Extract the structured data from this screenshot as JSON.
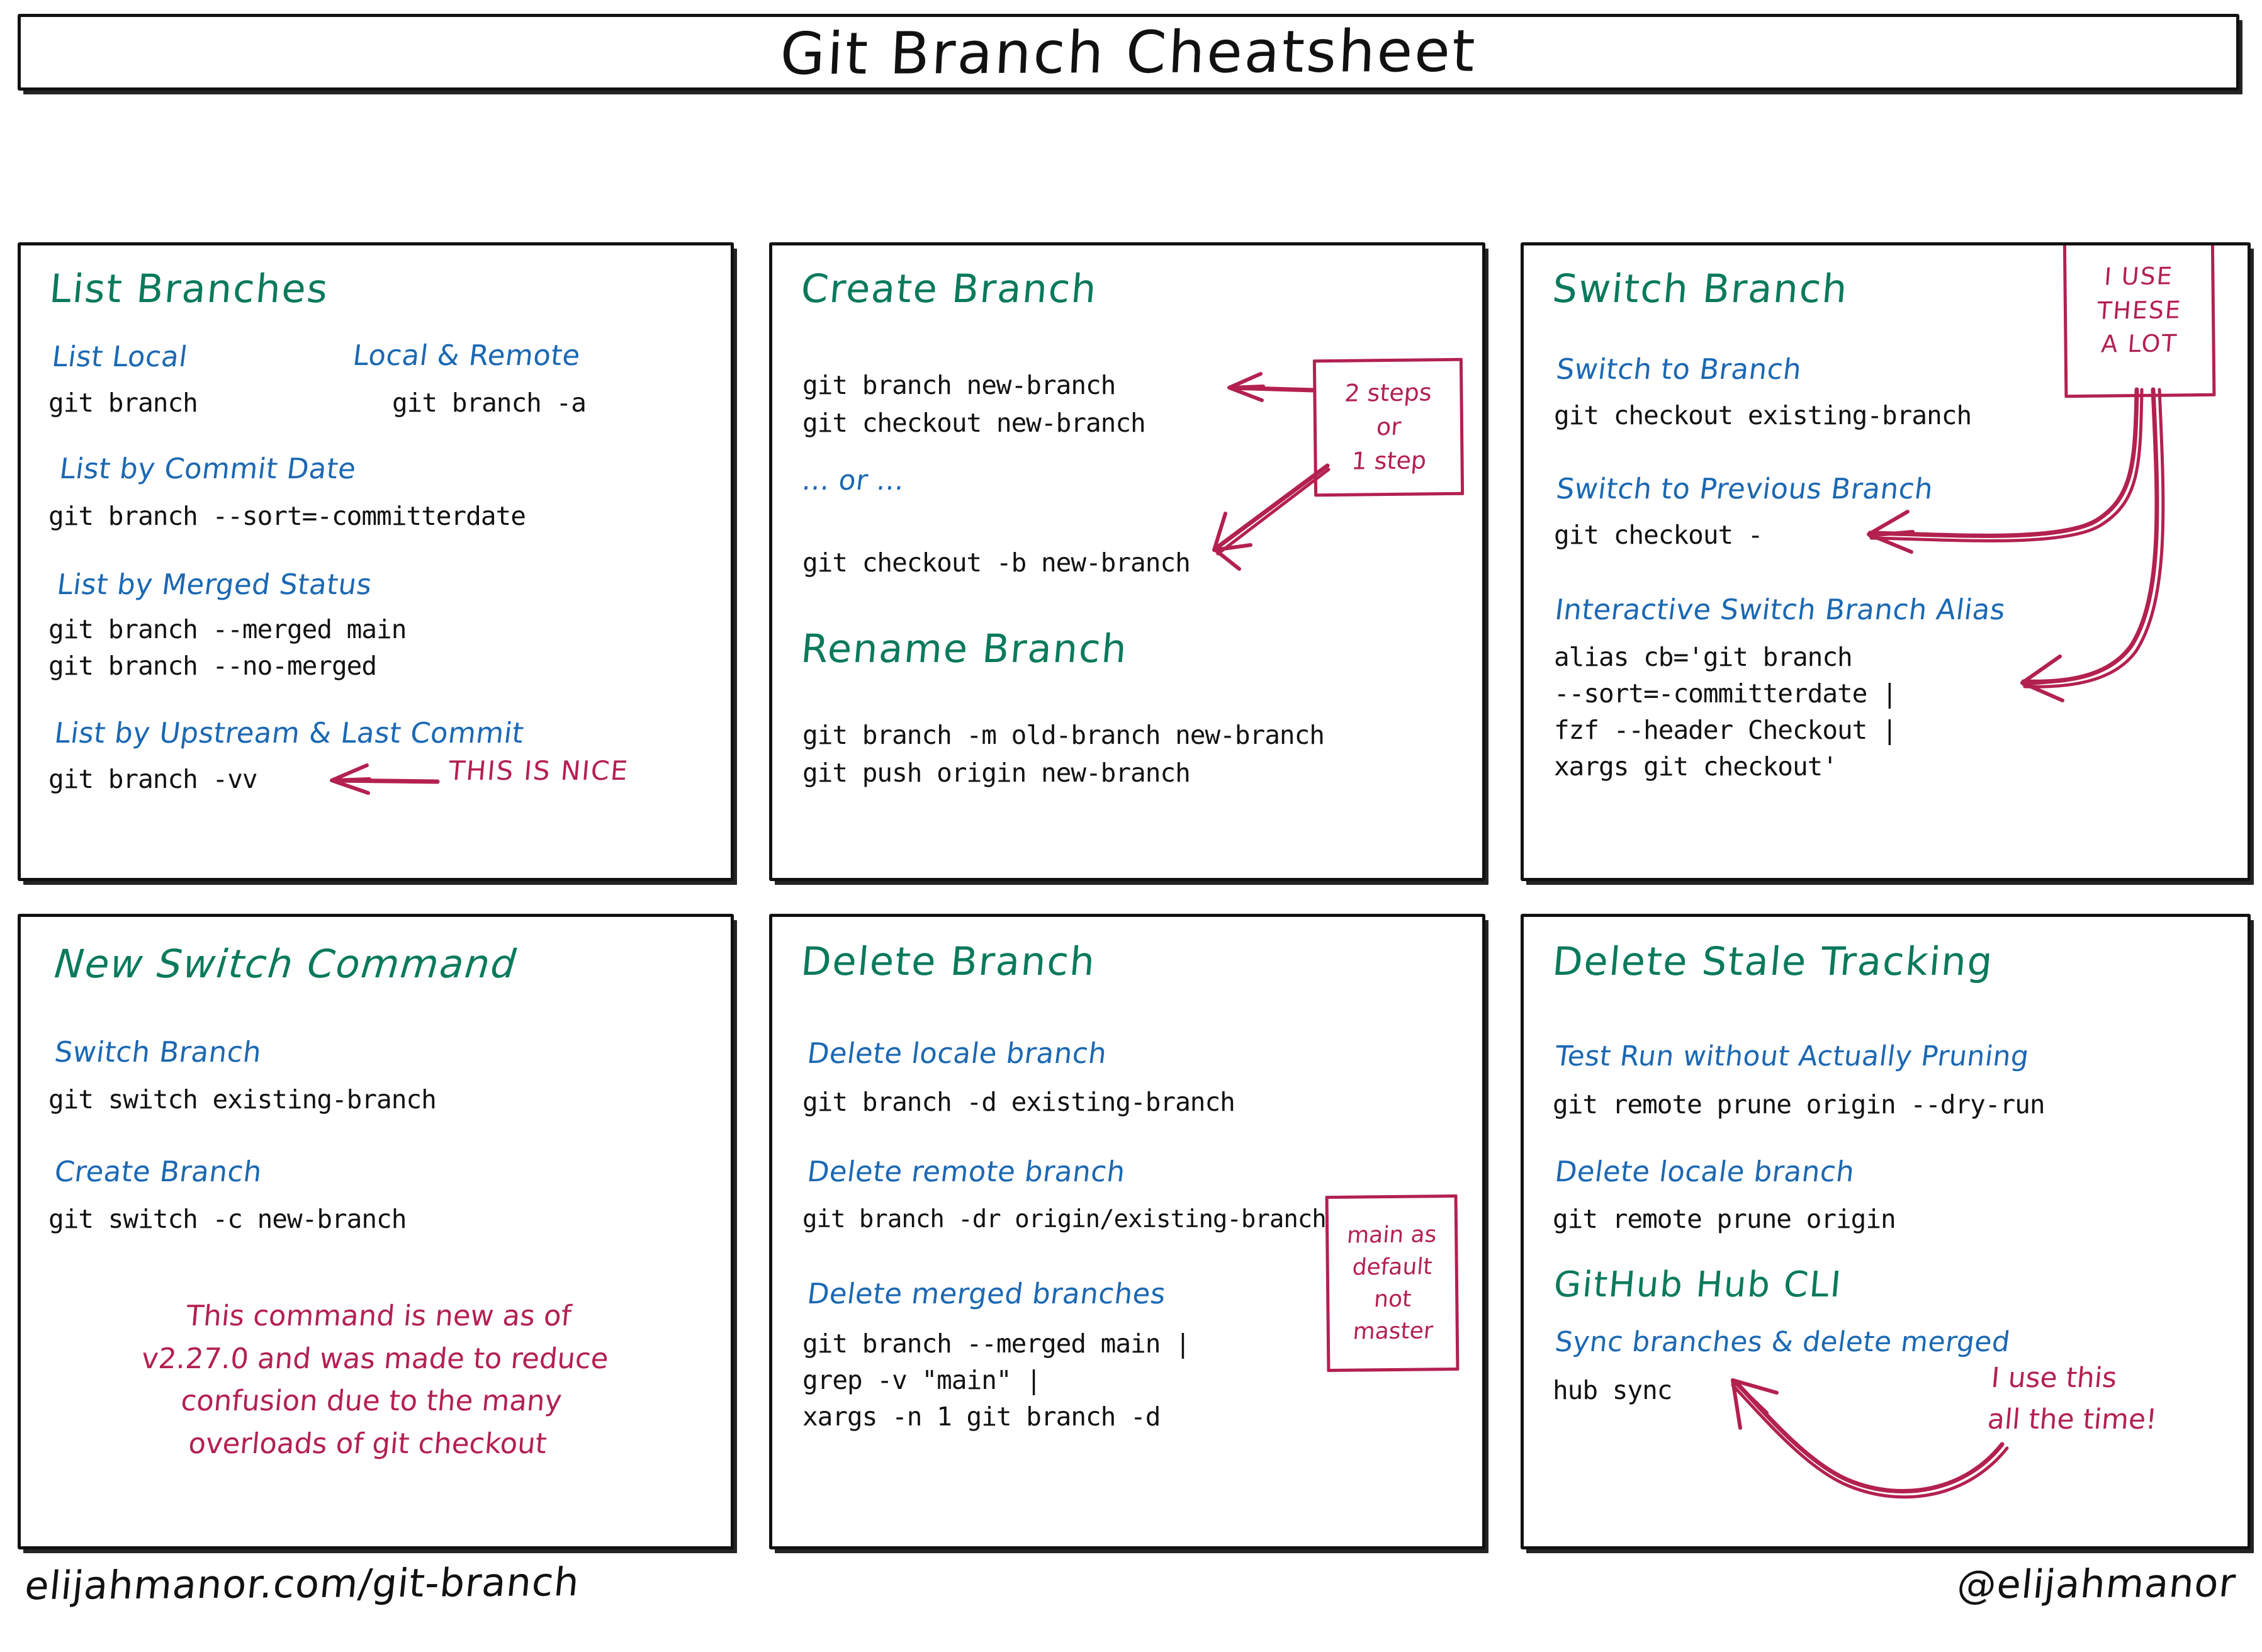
{
  "title": "Git Branch Cheatsheet",
  "colors": {
    "heading_green": "#0a7a5c",
    "subheading_blue": "#1b68b3",
    "annotation_crimson": "#b3214f",
    "code_black": "#111111",
    "background": "#ffffff"
  },
  "panels": {
    "list_branches": {
      "heading": "List Branches",
      "sub_list_local": "List Local",
      "code_list_local": "git branch",
      "sub_local_remote": "Local & Remote",
      "code_local_remote": "git branch -a",
      "sub_commit_date": "List by Commit Date",
      "code_commit_date": "git branch --sort=-committerdate",
      "sub_merged_status": "List by Merged Status",
      "code_merged_1": "git branch --merged main",
      "code_merged_2": "git branch --no-merged",
      "sub_upstream": "List by Upstream & Last Commit",
      "code_upstream": "git branch -vv",
      "annotation_nice": "THIS IS NICE"
    },
    "create_branch": {
      "heading": "Create Branch",
      "code_1": "git branch new-branch",
      "code_2": "git checkout new-branch",
      "or_text": "... or ...",
      "code_3": "git checkout -b new-branch",
      "callout_line_1": "2 steps",
      "callout_line_2": "or",
      "callout_line_3": "1 step",
      "rename_heading": "Rename Branch",
      "rename_code_1": "git branch -m old-branch new-branch",
      "rename_code_2": "git push origin new-branch"
    },
    "switch_branch": {
      "heading": "Switch Branch",
      "callout_line_1": "I USE",
      "callout_line_2": "THESE",
      "callout_line_3": "A LOT",
      "sub_switch_to": "Switch to Branch",
      "code_switch_to": "git checkout existing-branch",
      "sub_previous": "Switch to Previous Branch",
      "code_previous": "git checkout -",
      "sub_alias": "Interactive Switch Branch Alias",
      "code_alias_1": "alias cb='git branch",
      "code_alias_2": "--sort=-committerdate |",
      "code_alias_3": "fzf --header Checkout |",
      "code_alias_4": "xargs git checkout'"
    },
    "new_switch": {
      "heading": "New Switch Command",
      "sub_switch": "Switch Branch",
      "code_switch": "git switch existing-branch",
      "sub_create": "Create Branch",
      "code_create": "git switch -c new-branch",
      "note_line_1": "This command is new as of",
      "note_line_2": "v2.27.0 and was made to reduce",
      "note_line_3": "confusion due to the many",
      "note_line_4": "overloads of git checkout"
    },
    "delete_branch": {
      "heading": "Delete Branch",
      "sub_local": "Delete locale branch",
      "code_local": "git branch -d existing-branch",
      "sub_remote": "Delete remote branch",
      "code_remote": "git branch -dr origin/existing-branch",
      "sub_merged": "Delete merged branches",
      "code_merged_1": "git branch --merged main |",
      "code_merged_2": "grep -v \"main\" |",
      "code_merged_3": "xargs -n 1 git branch -d",
      "callout_line_1": "main as",
      "callout_line_2": "default",
      "callout_line_3": "not",
      "callout_line_4": "master"
    },
    "delete_stale": {
      "heading": "Delete Stale Tracking",
      "sub_dry_run": "Test Run without Actually Pruning",
      "code_dry_run": "git remote prune origin --dry-run",
      "sub_local": "Delete locale branch",
      "code_local": "git remote prune origin",
      "hub_heading": "GitHub Hub CLI",
      "sub_sync": "Sync branches & delete merged",
      "code_sync": "hub sync",
      "annotation_line_1": "I use this",
      "annotation_line_2": "all the time!"
    }
  },
  "footer": {
    "left": "elijahmanor.com/git-branch",
    "right": "@elijahmanor"
  }
}
